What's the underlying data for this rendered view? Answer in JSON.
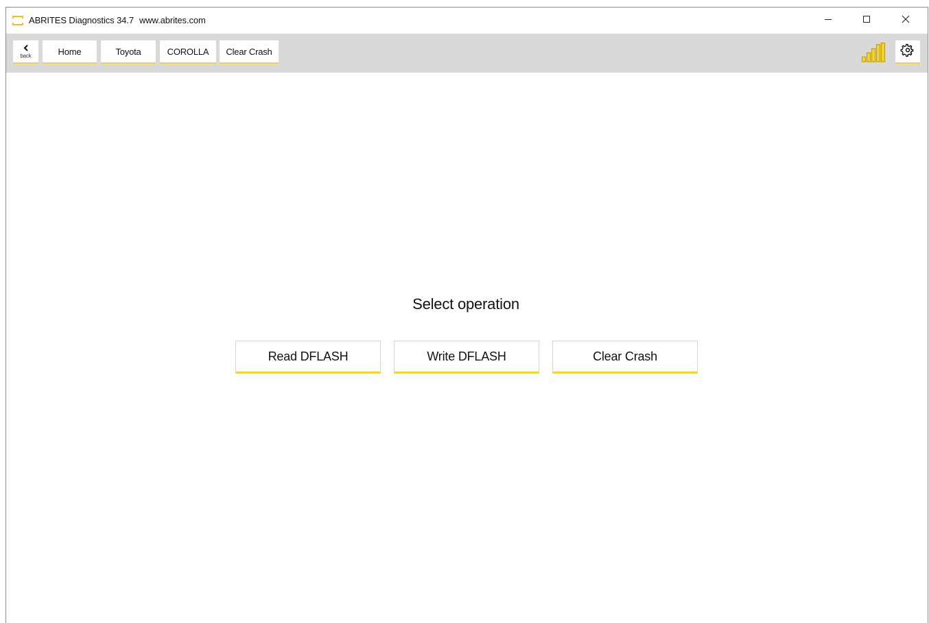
{
  "window": {
    "title": "ABRITES Diagnostics 34.7",
    "url": "www.abrites.com",
    "controls": {
      "minimize": "minimize-icon",
      "maximize": "maximize-icon",
      "close": "close-icon"
    }
  },
  "toolbar": {
    "back_label": "back",
    "breadcrumbs": [
      {
        "label": "Home"
      },
      {
        "label": "Toyota"
      },
      {
        "label": "COROLLA"
      },
      {
        "label": "Clear Crash"
      }
    ],
    "signal_icon": "signal-strength-icon",
    "settings_icon": "gear-icon"
  },
  "main": {
    "title": "Select operation",
    "operations": [
      {
        "label": "Read DFLASH"
      },
      {
        "label": "Write DFLASH"
      },
      {
        "label": "Clear Crash"
      }
    ]
  },
  "colors": {
    "accent": "#f2d43a",
    "toolbar_bg": "#d9d9d9",
    "background": "#ffffff"
  }
}
